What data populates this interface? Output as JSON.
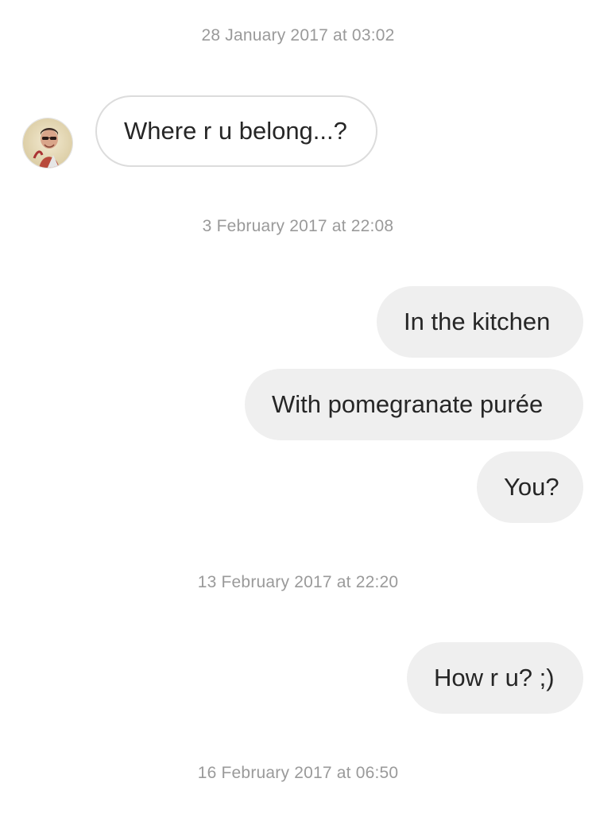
{
  "conversation": {
    "timestamps": [
      "28 January 2017 at 03:02",
      "3 February 2017 at 22:08",
      "13 February 2017 at 22:20",
      "16 February 2017 at 06:50"
    ],
    "messages": [
      {
        "direction": "incoming",
        "text": "Where r u belong...?"
      },
      {
        "direction": "outgoing",
        "text": "In the kitchen"
      },
      {
        "direction": "outgoing",
        "text": "With pomegranate purée"
      },
      {
        "direction": "outgoing",
        "text": "You?"
      },
      {
        "direction": "outgoing",
        "text": "How r u? ;)"
      }
    ]
  },
  "colors": {
    "incoming_bubble_border": "#dcdcdc",
    "outgoing_bubble_bg": "#efefef",
    "timestamp_text": "#9a9a9a",
    "message_text": "#262626"
  }
}
